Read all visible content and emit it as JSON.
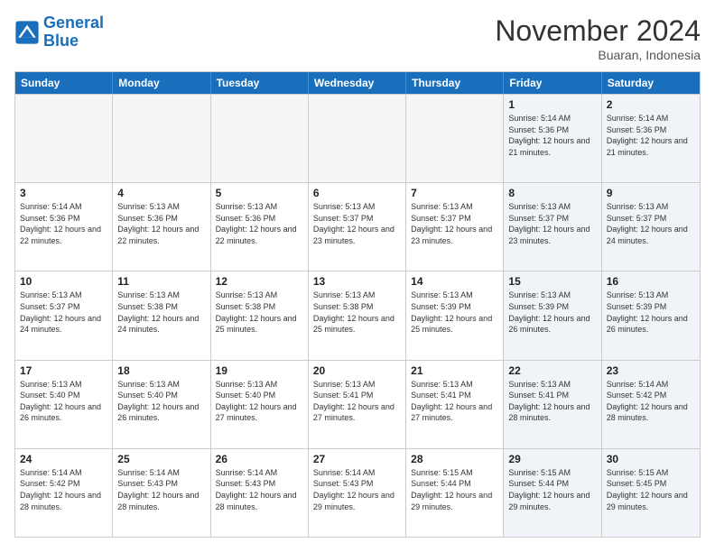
{
  "logo": {
    "line1": "General",
    "line2": "Blue"
  },
  "title": "November 2024",
  "location": "Buaran, Indonesia",
  "days_of_week": [
    "Sunday",
    "Monday",
    "Tuesday",
    "Wednesday",
    "Thursday",
    "Friday",
    "Saturday"
  ],
  "weeks": [
    [
      {
        "day": "",
        "empty": true
      },
      {
        "day": "",
        "empty": true
      },
      {
        "day": "",
        "empty": true
      },
      {
        "day": "",
        "empty": true
      },
      {
        "day": "",
        "empty": true
      },
      {
        "day": "1",
        "sunrise": "5:14 AM",
        "sunset": "5:36 PM",
        "daylight": "12 hours and 21 minutes."
      },
      {
        "day": "2",
        "sunrise": "5:14 AM",
        "sunset": "5:36 PM",
        "daylight": "12 hours and 21 minutes."
      }
    ],
    [
      {
        "day": "3",
        "sunrise": "5:14 AM",
        "sunset": "5:36 PM",
        "daylight": "12 hours and 22 minutes."
      },
      {
        "day": "4",
        "sunrise": "5:13 AM",
        "sunset": "5:36 PM",
        "daylight": "12 hours and 22 minutes."
      },
      {
        "day": "5",
        "sunrise": "5:13 AM",
        "sunset": "5:36 PM",
        "daylight": "12 hours and 22 minutes."
      },
      {
        "day": "6",
        "sunrise": "5:13 AM",
        "sunset": "5:37 PM",
        "daylight": "12 hours and 23 minutes."
      },
      {
        "day": "7",
        "sunrise": "5:13 AM",
        "sunset": "5:37 PM",
        "daylight": "12 hours and 23 minutes."
      },
      {
        "day": "8",
        "sunrise": "5:13 AM",
        "sunset": "5:37 PM",
        "daylight": "12 hours and 23 minutes."
      },
      {
        "day": "9",
        "sunrise": "5:13 AM",
        "sunset": "5:37 PM",
        "daylight": "12 hours and 24 minutes."
      }
    ],
    [
      {
        "day": "10",
        "sunrise": "5:13 AM",
        "sunset": "5:37 PM",
        "daylight": "12 hours and 24 minutes."
      },
      {
        "day": "11",
        "sunrise": "5:13 AM",
        "sunset": "5:38 PM",
        "daylight": "12 hours and 24 minutes."
      },
      {
        "day": "12",
        "sunrise": "5:13 AM",
        "sunset": "5:38 PM",
        "daylight": "12 hours and 25 minutes."
      },
      {
        "day": "13",
        "sunrise": "5:13 AM",
        "sunset": "5:38 PM",
        "daylight": "12 hours and 25 minutes."
      },
      {
        "day": "14",
        "sunrise": "5:13 AM",
        "sunset": "5:39 PM",
        "daylight": "12 hours and 25 minutes."
      },
      {
        "day": "15",
        "sunrise": "5:13 AM",
        "sunset": "5:39 PM",
        "daylight": "12 hours and 26 minutes."
      },
      {
        "day": "16",
        "sunrise": "5:13 AM",
        "sunset": "5:39 PM",
        "daylight": "12 hours and 26 minutes."
      }
    ],
    [
      {
        "day": "17",
        "sunrise": "5:13 AM",
        "sunset": "5:40 PM",
        "daylight": "12 hours and 26 minutes."
      },
      {
        "day": "18",
        "sunrise": "5:13 AM",
        "sunset": "5:40 PM",
        "daylight": "12 hours and 26 minutes."
      },
      {
        "day": "19",
        "sunrise": "5:13 AM",
        "sunset": "5:40 PM",
        "daylight": "12 hours and 27 minutes."
      },
      {
        "day": "20",
        "sunrise": "5:13 AM",
        "sunset": "5:41 PM",
        "daylight": "12 hours and 27 minutes."
      },
      {
        "day": "21",
        "sunrise": "5:13 AM",
        "sunset": "5:41 PM",
        "daylight": "12 hours and 27 minutes."
      },
      {
        "day": "22",
        "sunrise": "5:13 AM",
        "sunset": "5:41 PM",
        "daylight": "12 hours and 28 minutes."
      },
      {
        "day": "23",
        "sunrise": "5:14 AM",
        "sunset": "5:42 PM",
        "daylight": "12 hours and 28 minutes."
      }
    ],
    [
      {
        "day": "24",
        "sunrise": "5:14 AM",
        "sunset": "5:42 PM",
        "daylight": "12 hours and 28 minutes."
      },
      {
        "day": "25",
        "sunrise": "5:14 AM",
        "sunset": "5:43 PM",
        "daylight": "12 hours and 28 minutes."
      },
      {
        "day": "26",
        "sunrise": "5:14 AM",
        "sunset": "5:43 PM",
        "daylight": "12 hours and 28 minutes."
      },
      {
        "day": "27",
        "sunrise": "5:14 AM",
        "sunset": "5:43 PM",
        "daylight": "12 hours and 29 minutes."
      },
      {
        "day": "28",
        "sunrise": "5:15 AM",
        "sunset": "5:44 PM",
        "daylight": "12 hours and 29 minutes."
      },
      {
        "day": "29",
        "sunrise": "5:15 AM",
        "sunset": "5:44 PM",
        "daylight": "12 hours and 29 minutes."
      },
      {
        "day": "30",
        "sunrise": "5:15 AM",
        "sunset": "5:45 PM",
        "daylight": "12 hours and 29 minutes."
      }
    ]
  ]
}
